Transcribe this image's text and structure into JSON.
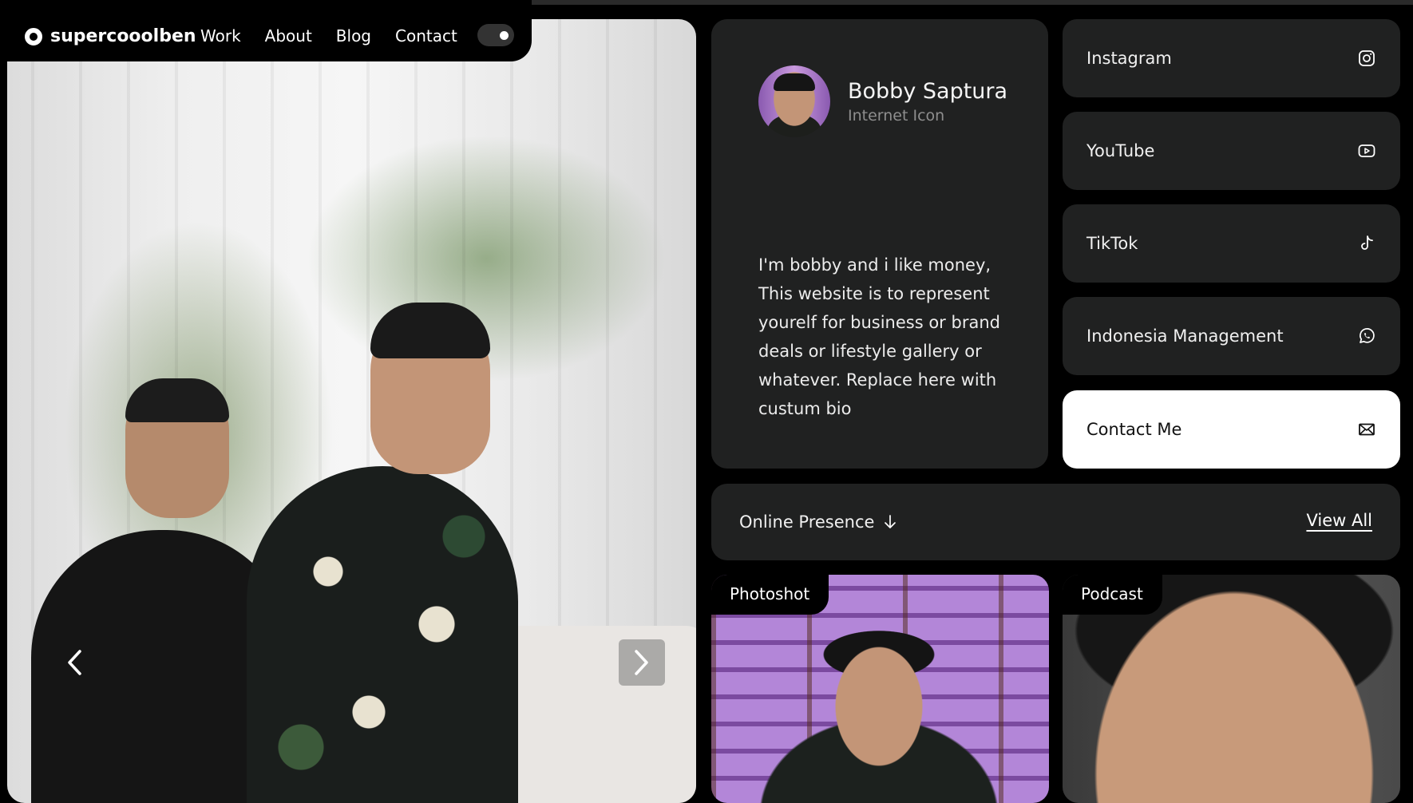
{
  "brand": {
    "name": "supercooolben"
  },
  "nav": {
    "items": [
      "Work",
      "About",
      "Blog",
      "Contact"
    ]
  },
  "theme_toggle": {
    "state": "dark"
  },
  "profile": {
    "name": "Bobby Saptura",
    "title": "Internet Icon",
    "bio": "I'm bobby and i like money, This website is to represent yourelf for business or brand deals or lifestyle gallery or whatever. Replace here with custum bio"
  },
  "links": [
    {
      "label": "Instagram",
      "icon": "instagram-icon"
    },
    {
      "label": "YouTube",
      "icon": "youtube-icon"
    },
    {
      "label": "TikTok",
      "icon": "tiktok-icon"
    },
    {
      "label": "Indonesia Management",
      "icon": "whatsapp-icon"
    },
    {
      "label": "Contact Me",
      "icon": "mail-icon"
    }
  ],
  "presence": {
    "label": "Online Presence",
    "view_all": "View All"
  },
  "tiles": [
    {
      "label": "Photoshot"
    },
    {
      "label": "Podcast"
    }
  ],
  "colors": {
    "background": "#000000",
    "card": "#202121",
    "accent_card": "#ffffff",
    "muted_text": "#8e8e8e"
  }
}
